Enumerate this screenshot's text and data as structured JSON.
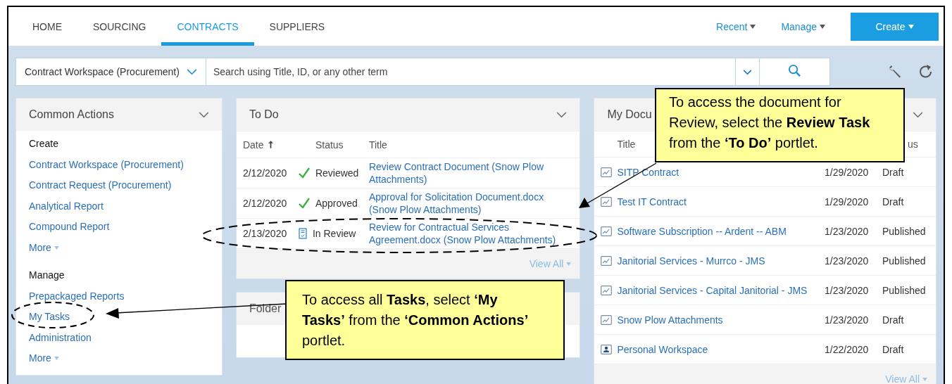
{
  "nav": {
    "tabs": [
      {
        "label": "HOME",
        "selected": false
      },
      {
        "label": "SOURCING",
        "selected": false
      },
      {
        "label": "CONTRACTS",
        "selected": true
      },
      {
        "label": "SUPPLIERS",
        "selected": false
      }
    ],
    "menus": [
      "Recent",
      "Manage"
    ],
    "create_button": "Create"
  },
  "search": {
    "scope": "Contract Workspace (Procurement)",
    "placeholder": "Search using Title, ID, or any other term"
  },
  "common_actions": {
    "title": "Common Actions",
    "sections": [
      {
        "heading": "Create",
        "links": [
          "Contract Workspace (Procurement)",
          "Contract Request (Procurement)",
          "Analytical Report",
          "Compound Report"
        ],
        "more": "More"
      },
      {
        "heading": "Manage",
        "links": [
          "Prepackaged Reports",
          "My Tasks",
          "Administration"
        ],
        "more": "More"
      }
    ]
  },
  "todo": {
    "title": "To Do",
    "columns": [
      "Date",
      "Status",
      "Title"
    ],
    "rows": [
      {
        "date": "2/12/2020",
        "kind": "done",
        "status": "Reviewed",
        "title": "Review Contract Document (Snow Plow Attachments)"
      },
      {
        "date": "2/12/2020",
        "kind": "done",
        "status": "Approved",
        "title": "Approval for Solicitation Document.docx (Snow Plow Attachments)"
      },
      {
        "date": "2/13/2020",
        "kind": "review",
        "status": "In Review",
        "title": "Review for Contractual Services Agreement.docx (Snow Plow Attachments)"
      }
    ],
    "view_all": "View All"
  },
  "folder": {
    "title": "Folder"
  },
  "my_documents": {
    "title": "My Docu",
    "columns": [
      "Title",
      "us"
    ],
    "rows": [
      {
        "kind": "contract",
        "title": "SITP Contract",
        "date": "1/29/2020",
        "status": "Draft"
      },
      {
        "kind": "contract",
        "title": "Test IT Contract",
        "date": "1/29/2020",
        "status": "Draft"
      },
      {
        "kind": "contract",
        "title": "Software Subscription -- Ardent -- ABM",
        "date": "1/23/2020",
        "status": "Published"
      },
      {
        "kind": "contract",
        "title": "Janitorial Services - Murrco - JMS",
        "date": "1/23/2020",
        "status": "Published"
      },
      {
        "kind": "contract",
        "title": "Janitorial Services - Capital Janitorial - JMS",
        "date": "1/23/2020",
        "status": "Published"
      },
      {
        "kind": "contract",
        "title": "Snow Plow Attachments",
        "date": "1/23/2020",
        "status": "Draft"
      },
      {
        "kind": "workspace",
        "title": "Personal Workspace",
        "date": "1/22/2020",
        "status": "Draft"
      }
    ],
    "view_all": "View All"
  },
  "callouts": [
    {
      "text": "To access the document for Review, select the **Review Task** from the **‘To Do’** portlet."
    },
    {
      "text": "To access all **Tasks**, select **‘My Tasks’** from the **‘Common Actions’** portlet."
    }
  ]
}
